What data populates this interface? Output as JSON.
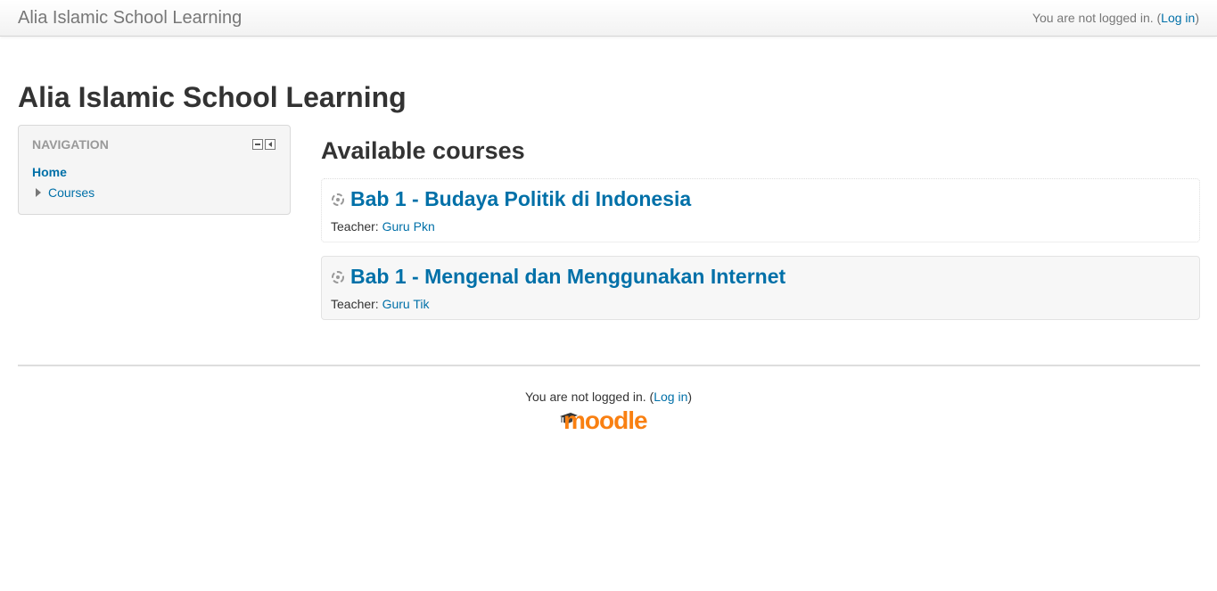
{
  "navbar": {
    "brand": "Alia Islamic School Learning",
    "login_prefix": "You are not logged in. (",
    "login_link": "Log in",
    "login_suffix": ")"
  },
  "page": {
    "heading": "Alia Islamic School Learning"
  },
  "navigation_block": {
    "title": "NAVIGATION",
    "home": "Home",
    "courses": "Courses"
  },
  "main": {
    "heading": "Available courses",
    "courses": [
      {
        "name": "Bab 1 - Budaya Politik di Indonesia",
        "teacher_label": "Teacher:",
        "teacher": "Guru Pkn"
      },
      {
        "name": "Bab 1 - Mengenal dan Menggunakan Internet",
        "teacher_label": "Teacher:",
        "teacher": "Guru Tik"
      }
    ]
  },
  "footer": {
    "login_prefix": "You are not logged in. (",
    "login_link": "Log in",
    "login_suffix": ")",
    "logo_text": "moodle"
  },
  "colors": {
    "link": "#0070a8",
    "moodle_orange": "#f98012"
  }
}
